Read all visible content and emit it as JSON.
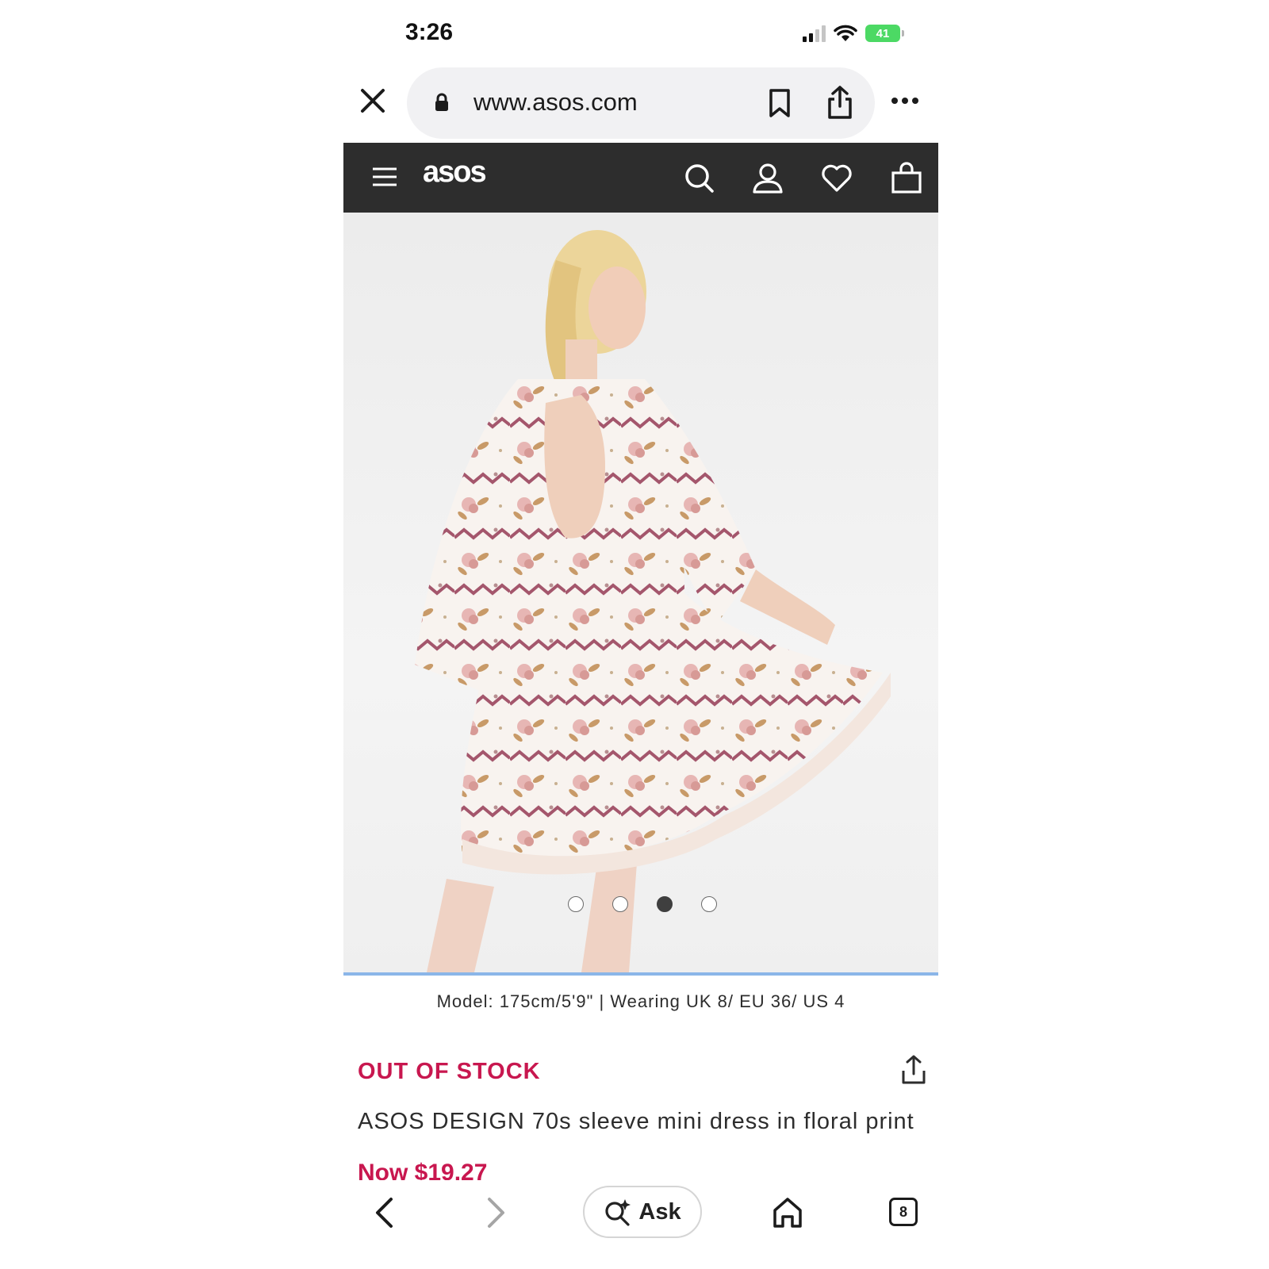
{
  "status_bar": {
    "time": "3:26",
    "battery": "41"
  },
  "browser": {
    "url": "www.asos.com"
  },
  "site": {
    "logo": "asos"
  },
  "product": {
    "image_dots_count": 4,
    "active_image_index": 3,
    "model_info": "Model: 175cm/5'9\" | Wearing UK 8/ EU 36/ US 4",
    "stock_status": "OUT OF STOCK",
    "title": "ASOS DESIGN 70s sleeve mini dress in floral print",
    "price": "Now $19.27"
  },
  "toolbar": {
    "ask_label": "Ask",
    "tabs_count": "8"
  },
  "colors": {
    "header_bg": "#2d2d2d",
    "accent": "#c8174f",
    "battery": "#4cd964"
  }
}
